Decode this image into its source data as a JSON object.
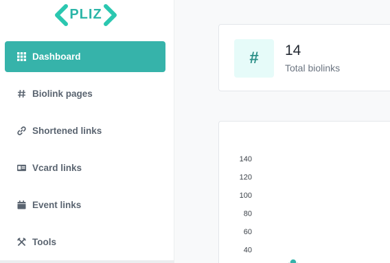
{
  "brand": {
    "name": "PLIZ",
    "color": "#2bb5a8"
  },
  "sidebar": {
    "items": [
      {
        "label": "Dashboard",
        "icon": "grid-icon",
        "active": true
      },
      {
        "label": "Biolink pages",
        "icon": "hash-icon",
        "active": false
      },
      {
        "label": "Shortened links",
        "icon": "link-icon",
        "active": false
      },
      {
        "label": "Vcard links",
        "icon": "id-card-icon",
        "active": false
      },
      {
        "label": "Event links",
        "icon": "calendar-icon",
        "active": false
      },
      {
        "label": "Tools",
        "icon": "tools-icon",
        "active": false
      }
    ]
  },
  "stats": {
    "total_biolinks": {
      "icon_glyph": "#",
      "value": "14",
      "label": "Total biolinks"
    }
  },
  "colors": {
    "accent": "#36b3aa",
    "icon_bg": "#e6fbf9",
    "icon_fg": "#2a8f87"
  },
  "chart_data": {
    "type": "line",
    "title": "",
    "xlabel": "",
    "ylabel": "",
    "ylim": [
      0,
      140
    ],
    "yticks": [
      40,
      60,
      80,
      100,
      120,
      140
    ],
    "series": [
      {
        "values": [
          26
        ]
      }
    ]
  }
}
